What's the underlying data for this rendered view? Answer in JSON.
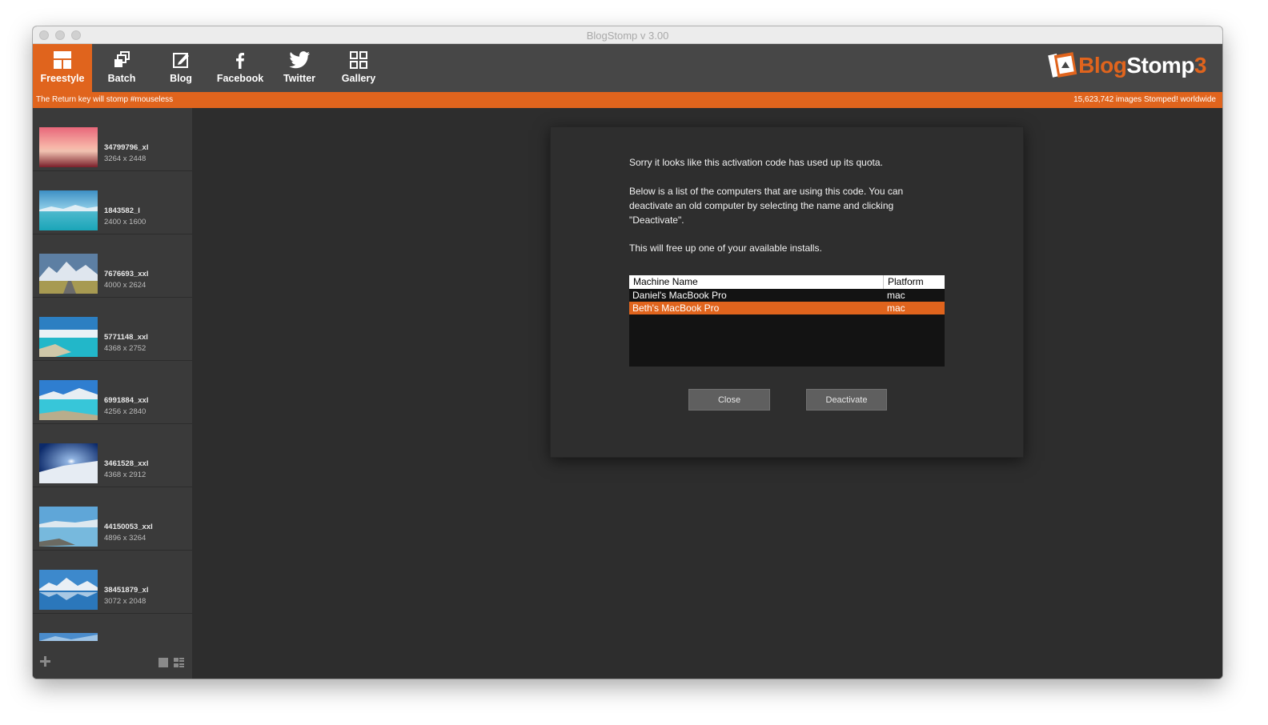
{
  "window": {
    "title": "BlogStomp v 3.00"
  },
  "toolbar": {
    "items": [
      {
        "label": "Freestyle",
        "icon": "freestyle-layout-icon",
        "active": true
      },
      {
        "label": "Batch",
        "icon": "batch-stack-icon",
        "active": false
      },
      {
        "label": "Blog",
        "icon": "blog-edit-icon",
        "active": false
      },
      {
        "label": "Facebook",
        "icon": "facebook-icon",
        "active": false
      },
      {
        "label": "Twitter",
        "icon": "twitter-bird-icon",
        "active": false
      },
      {
        "label": "Gallery",
        "icon": "gallery-grid-icon",
        "active": false
      }
    ],
    "logo": {
      "part1": "Blog",
      "part2": "Stomp",
      "part3": "3"
    }
  },
  "strip": {
    "left": "The Return key will stomp #mouseless",
    "right": "15,623,742 images Stomped! worldwide"
  },
  "sidebar": {
    "items": [
      {
        "name": "34799796_xl",
        "size": "3264 x 2448"
      },
      {
        "name": "1843582_l",
        "size": "2400 x 1600"
      },
      {
        "name": "7676693_xxl",
        "size": "4000 x 2624"
      },
      {
        "name": "5771148_xxl",
        "size": "4368 x 2752"
      },
      {
        "name": "6991884_xxl",
        "size": "4256 x 2840"
      },
      {
        "name": "3461528_xxl",
        "size": "4368 x 2912"
      },
      {
        "name": "44150053_xxl",
        "size": "4896 x 3264"
      },
      {
        "name": "38451879_xl",
        "size": "3072 x 2048"
      }
    ],
    "add_icon": "plus-icon",
    "view_icons": [
      "single-view-icon",
      "list-view-icon"
    ]
  },
  "dialog": {
    "message1": "Sorry it looks like this activation code has used up its quota.",
    "message2a": "Below is a list of the computers that are using this code.  You can",
    "message2b": "deactivate an old computer by selecting the name and clicking",
    "message2c": "\"Deactivate\".",
    "message3": "This will free up one of your available installs.",
    "table": {
      "headers": {
        "machine": "Machine Name",
        "platform": "Platform"
      },
      "rows": [
        {
          "machine": "Daniel's MacBook Pro",
          "platform": "mac",
          "selected": false
        },
        {
          "machine": "Beth's MacBook Pro",
          "platform": "mac",
          "selected": true
        }
      ]
    },
    "close_label": "Close",
    "deactivate_label": "Deactivate"
  },
  "colors": {
    "accent": "#e0641d",
    "toolbar": "#474747",
    "background": "#2d2d2d",
    "sidebar": "#3a3a3a"
  }
}
